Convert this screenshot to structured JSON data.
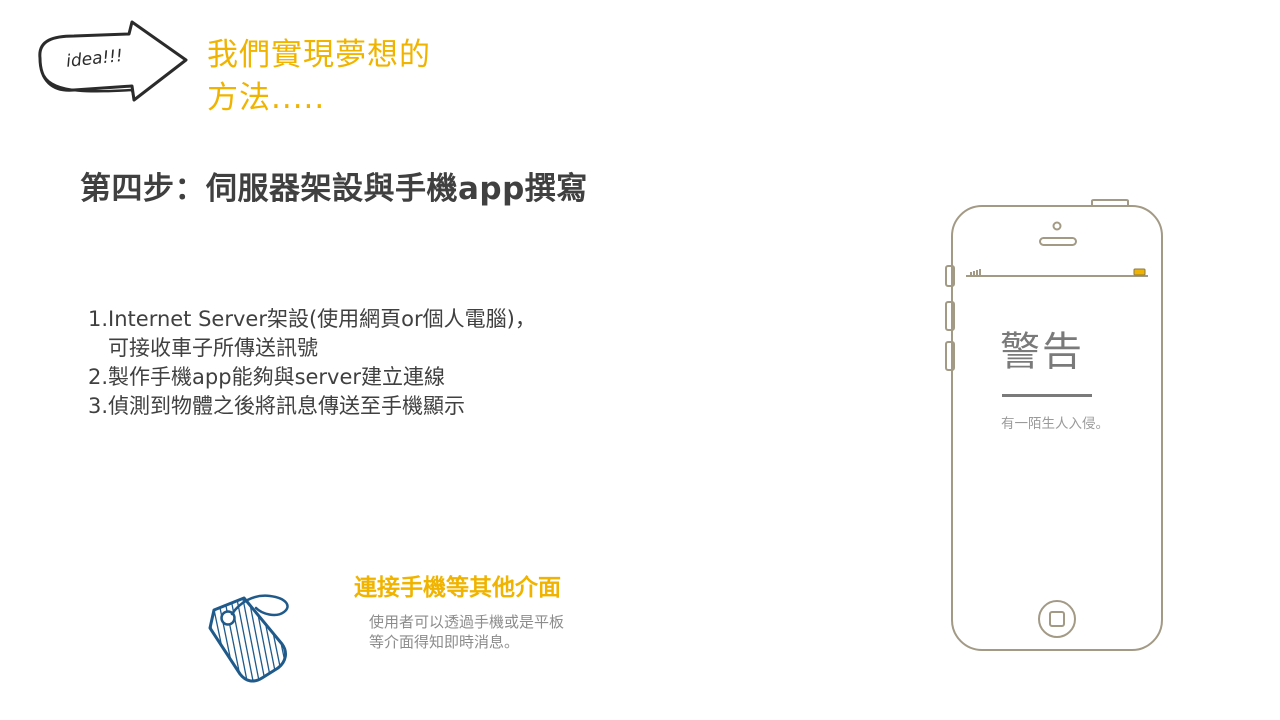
{
  "header": {
    "badge_text": "idea!!!",
    "headline_line1": "我們實現夢想的",
    "headline_line2": "方法....."
  },
  "step": {
    "title": "第四步：伺服器架設與手機app撰寫"
  },
  "items": [
    "1.Internet Server架設(使用網頁or個人電腦)，",
    "   可接收車子所傳送訊號",
    "2.製作手機app能夠與server建立連線",
    "3.偵測到物體之後將訊息傳送至手機顯示"
  ],
  "feature": {
    "icon": "tag-icon",
    "title": "連接手機等其他介面",
    "desc_line1": "使用者可以透過手機或是平板",
    "desc_line2": "等介面得知即時消息。"
  },
  "phone": {
    "icon": "smartphone-icon",
    "alert_title": "警告",
    "alert_message": "有一陌生人入侵。"
  },
  "colors": {
    "accent": "#f0b400",
    "text_dark": "#404040",
    "text_muted": "#8c8c8c",
    "phone_outline": "#a39a86",
    "tag_blue": "#1f5a8a"
  }
}
